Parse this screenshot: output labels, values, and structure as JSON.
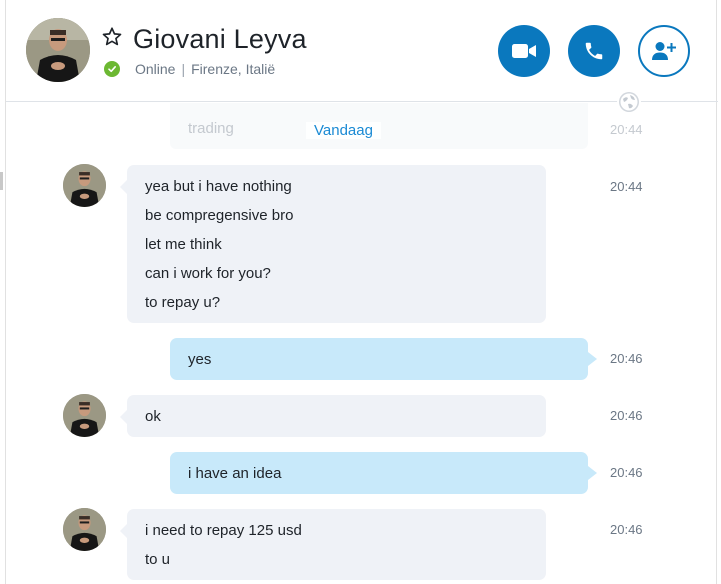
{
  "contact": {
    "name": "Giovani Leyva",
    "status": "Online",
    "location": "Firenze, Italië"
  },
  "colors": {
    "accent": "#0a78be",
    "online": "#6cb832",
    "incoming_bubble": "#eff2f7",
    "outgoing_bubble": "#c8e9fa"
  },
  "icons": {
    "favorite": "star-outline-icon",
    "video": "video-camera-icon",
    "call": "phone-icon",
    "add": "add-person-icon",
    "globe": "globe-icon"
  },
  "chat": {
    "previous_message": {
      "text": "trading",
      "time": "20:44"
    },
    "date_label": "Vandaag",
    "messages": [
      {
        "direction": "in",
        "time": "20:44",
        "lines": [
          "yea but i have nothing",
          "be compregensive bro",
          "let me think",
          "can i work for you?",
          "to repay u?"
        ]
      },
      {
        "direction": "out",
        "time": "20:46",
        "lines": [
          "yes"
        ]
      },
      {
        "direction": "in",
        "time": "20:46",
        "lines": [
          "ok"
        ]
      },
      {
        "direction": "out",
        "time": "20:46",
        "lines": [
          "i have an idea"
        ]
      },
      {
        "direction": "in",
        "time": "20:46",
        "lines": [
          "i need to repay 125 usd",
          "to u"
        ]
      }
    ]
  }
}
